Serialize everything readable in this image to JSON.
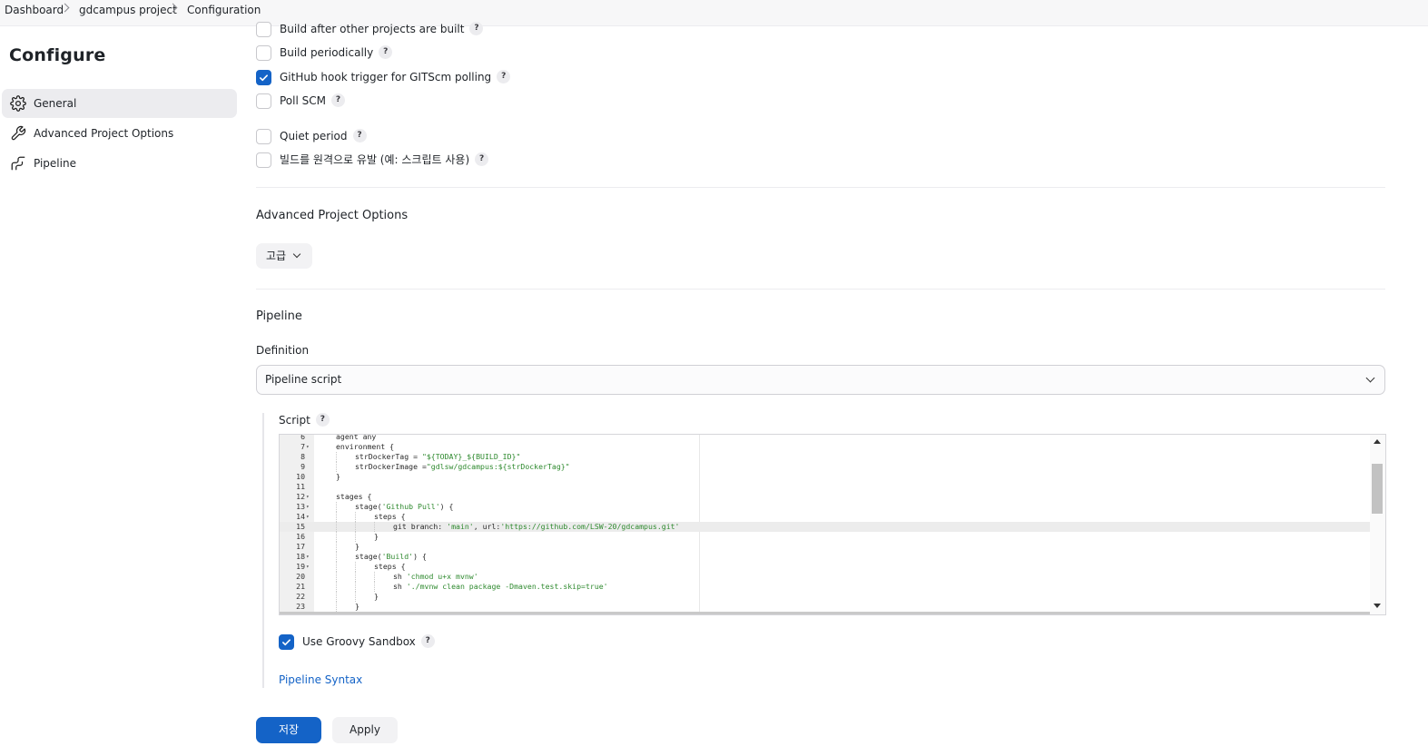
{
  "breadcrumb": {
    "items": [
      "Dashboard",
      "gdcampus project",
      "Configuration"
    ]
  },
  "sidebar": {
    "title": "Configure",
    "items": [
      {
        "label": "General",
        "icon": "gear-icon",
        "active": true
      },
      {
        "label": "Advanced Project Options",
        "icon": "wrench-icon",
        "active": false
      },
      {
        "label": "Pipeline",
        "icon": "pipeline-icon",
        "active": false
      }
    ]
  },
  "build_triggers": [
    {
      "label": "Build after other projects are built",
      "checked": false
    },
    {
      "label": "Build periodically",
      "checked": false
    },
    {
      "label": "GitHub hook trigger for GITScm polling",
      "checked": true
    },
    {
      "label": "Poll SCM",
      "checked": false
    },
    {
      "label": "Quiet period",
      "checked": false
    },
    {
      "label": "빌드를 원격으로 유발 (예: 스크립트 사용)",
      "checked": false
    }
  ],
  "advanced": {
    "title": "Advanced Project Options",
    "button_label": "고급"
  },
  "pipeline": {
    "title": "Pipeline",
    "definition_label": "Definition",
    "definition_value": "Pipeline script",
    "script_label": "Script",
    "code_lines": [
      {
        "n": "6",
        "fold": false,
        "indent": 1,
        "text": "agent any"
      },
      {
        "n": "7",
        "fold": true,
        "indent": 1,
        "text": "environment {"
      },
      {
        "n": "8",
        "fold": false,
        "indent": 2,
        "text": "strDockerTag = \"${TODAY}_${BUILD_ID}\""
      },
      {
        "n": "9",
        "fold": false,
        "indent": 2,
        "text": "strDockerImage =\"gdlsw/gdcampus:${strDockerTag}\""
      },
      {
        "n": "10",
        "fold": false,
        "indent": 1,
        "text": "}"
      },
      {
        "n": "11",
        "fold": false,
        "indent": 1,
        "text": ""
      },
      {
        "n": "12",
        "fold": true,
        "indent": 1,
        "text": "stages {"
      },
      {
        "n": "13",
        "fold": true,
        "indent": 2,
        "text": "stage('Github Pull') {"
      },
      {
        "n": "14",
        "fold": true,
        "indent": 3,
        "text": "steps {"
      },
      {
        "n": "15",
        "fold": false,
        "indent": 4,
        "text": "git branch: 'main', url:'https://github.com/LSW-20/gdcampus.git'"
      },
      {
        "n": "16",
        "fold": false,
        "indent": 3,
        "text": "}"
      },
      {
        "n": "17",
        "fold": false,
        "indent": 2,
        "text": "}"
      },
      {
        "n": "18",
        "fold": true,
        "indent": 2,
        "text": "stage('Build') {"
      },
      {
        "n": "19",
        "fold": true,
        "indent": 3,
        "text": "steps {"
      },
      {
        "n": "20",
        "fold": false,
        "indent": 4,
        "text": "sh 'chmod u+x mvnw'"
      },
      {
        "n": "21",
        "fold": false,
        "indent": 4,
        "text": "sh './mvnw clean package -Dmaven.test.skip=true'"
      },
      {
        "n": "22",
        "fold": false,
        "indent": 3,
        "text": "}"
      },
      {
        "n": "23",
        "fold": false,
        "indent": 2,
        "text": "}"
      }
    ],
    "active_line": "15",
    "sandbox_label": "Use Groovy Sandbox",
    "sandbox_checked": true,
    "syntax_link": "Pipeline Syntax"
  },
  "actions": {
    "save_label": "저장",
    "apply_label": "Apply"
  },
  "colors": {
    "accent": "#1463c7",
    "string": "#2f8a2f"
  }
}
